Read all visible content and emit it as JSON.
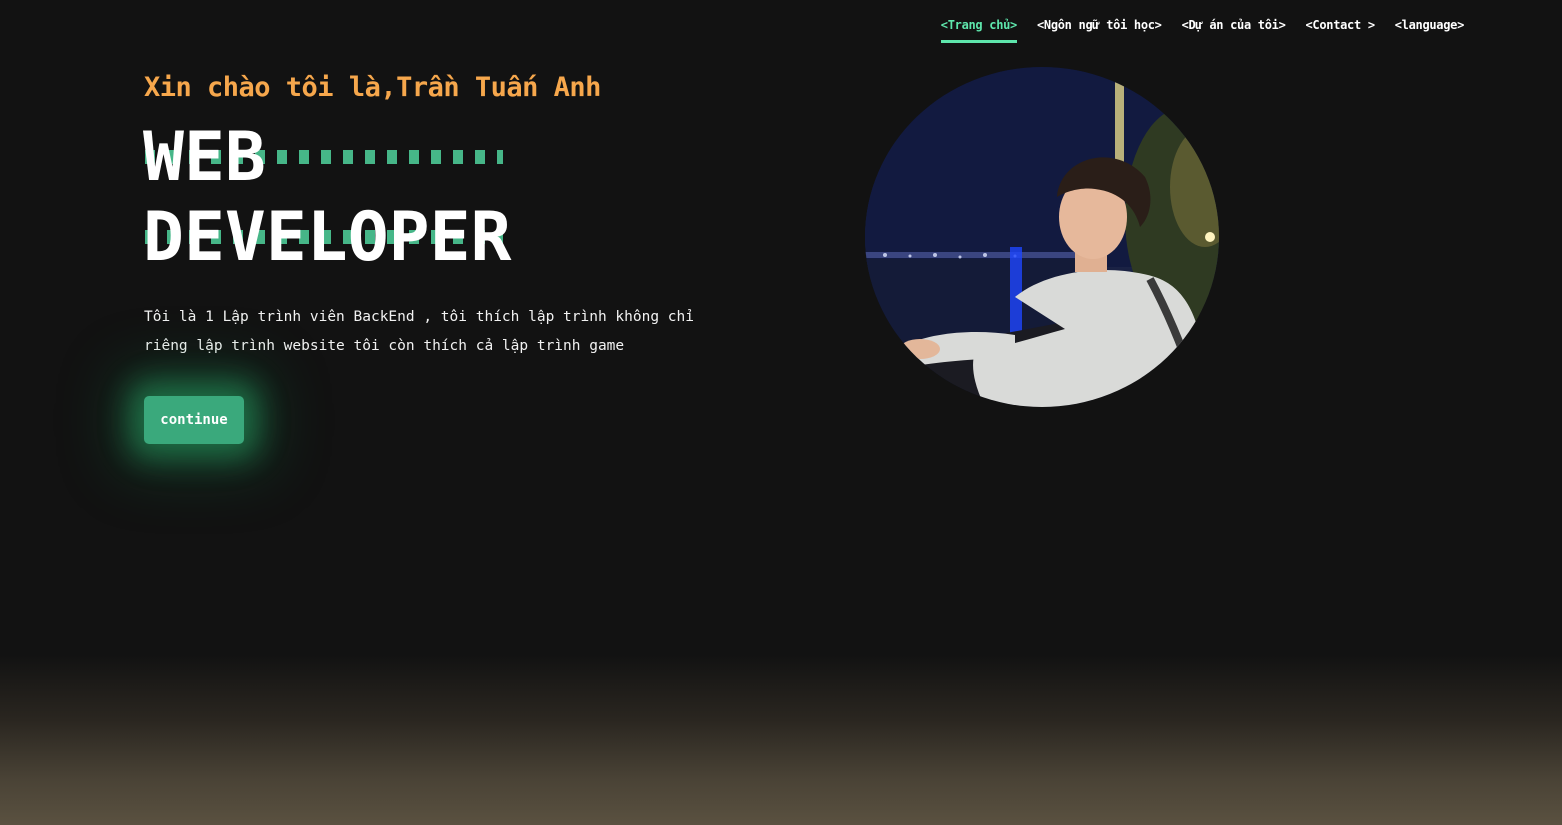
{
  "nav": {
    "items": [
      {
        "label": "<Trang chủ>",
        "active": true
      },
      {
        "label": "<Ngôn ngữ tôi học>",
        "active": false
      },
      {
        "label": "<Dự án của tôi>",
        "active": false
      },
      {
        "label": "<Contact >",
        "active": false
      },
      {
        "label": "<language>",
        "active": false
      }
    ]
  },
  "hero": {
    "greeting": "Xin chào tôi là,Trần Tuấn Anh",
    "title_line1": "WEB",
    "title_line2": "DEVELOPER",
    "bio": "Tôi là 1 Lập trình viên BackEnd , tôi thích lập trình không chỉ riêng lập trình website tôi còn thích cả lập trình game",
    "cta_label": "continue"
  },
  "colors": {
    "accent": "#5ee6ac",
    "greeting": "#f6a74c",
    "button": "#3aa97c",
    "background": "#121212"
  }
}
